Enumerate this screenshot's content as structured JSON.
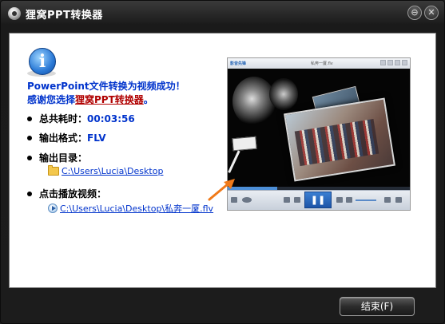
{
  "window": {
    "title": "狸窝PPT转换器",
    "min_label": "⊖",
    "close_label": "✕"
  },
  "message": {
    "line1": "PowerPoint文件转换为视频成功！",
    "line2_prefix": "感谢您选择",
    "line2_brand": "狸窝PPT转换器",
    "line2_suffix": "。"
  },
  "details": {
    "elapsed_label": "总共耗时：",
    "elapsed_value": "00:03:56",
    "format_label": "输出格式：",
    "format_value": "FLV",
    "dir_label": "输出目录：",
    "dir_path": "C:\\Users\\Lucia\\Desktop",
    "play_label": "点击播放视频：",
    "video_path": "C:\\Users\\Lucia\\Desktop\\私奔一厦.flv"
  },
  "player": {
    "app_label": "影音先锋",
    "file_title": "私奔一厦.flv",
    "progress": 0.27
  },
  "footer": {
    "finish_label": "结束(F)"
  },
  "colors": {
    "link": "#0033cc",
    "brand_red": "#b00000",
    "arrow": "#f07a1a"
  }
}
